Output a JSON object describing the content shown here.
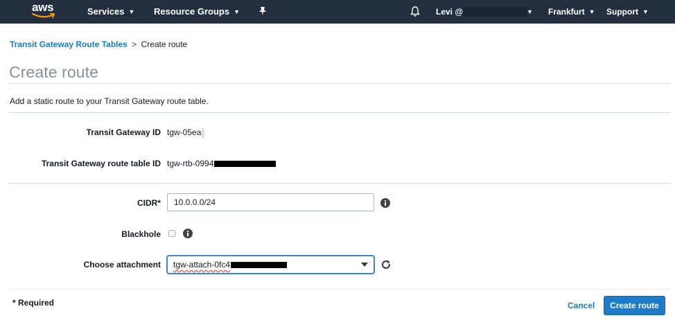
{
  "topbar": {
    "logo_text": "aws",
    "services_label": "Services",
    "resource_groups_label": "Resource Groups",
    "account_label": "Levi @",
    "region_label": "Frankfurt",
    "support_label": "Support",
    "bg_color": "#232f3e",
    "icons": [
      "aws-logo",
      "pin-icon",
      "bell-icon",
      "chevron-down-icon"
    ]
  },
  "breadcrumb": {
    "parent_label": "Transit Gateway Route Tables",
    "separator": ">",
    "current_label": "Create route"
  },
  "page": {
    "title": "Create route",
    "description": "Add a static route to your Transit Gateway route table."
  },
  "form": {
    "tgw_id_label": "Transit Gateway ID",
    "tgw_id_value": "tgw-05ea",
    "rtb_id_label": "Transit Gateway route table ID",
    "rtb_id_value": "tgw-rtb-0994",
    "cidr_label": "CIDR*",
    "cidr_value": "10.0.0.0/24",
    "blackhole_label": "Blackhole",
    "blackhole_checked": false,
    "attachment_label": "Choose attachment",
    "attachment_value": "tgw-attach-0fc4"
  },
  "footer": {
    "required_note": "* Required",
    "cancel_label": "Cancel",
    "create_label": "Create route",
    "accent_color": "#1e7bc7",
    "link_color": "#1a7bc1"
  }
}
